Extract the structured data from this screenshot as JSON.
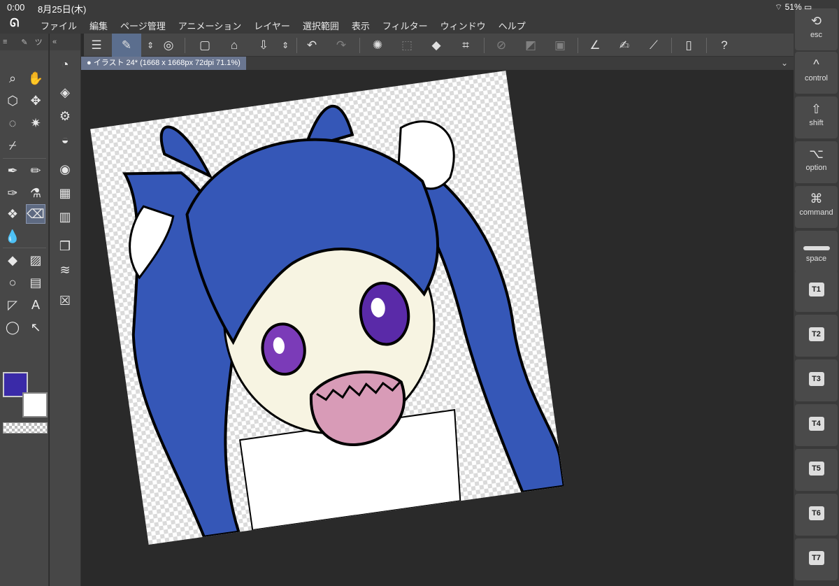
{
  "status": {
    "time": "0:00",
    "date": "8月25日(木)",
    "battery": "51%"
  },
  "menu": [
    "ファイル",
    "編集",
    "ページ管理",
    "アニメーション",
    "レイヤー",
    "選択範囲",
    "表示",
    "フィルター",
    "ウィンドウ",
    "ヘルプ"
  ],
  "document": {
    "tab_label": "● イラスト 24* (1668 x 1668px 72dpi 71.1%)"
  },
  "colors": {
    "main": "#3a2aa8",
    "sub": "#ffffff",
    "hair": "#3557b7",
    "skin": "#f7f4e2",
    "mouth": "#d89bb7",
    "eye": "#5a2aa8"
  },
  "keys": [
    {
      "glyph": "⟲",
      "label": "esc"
    },
    {
      "glyph": "^",
      "label": "control"
    },
    {
      "glyph": "⇧",
      "label": "shift"
    },
    {
      "glyph": "⌥",
      "label": "option"
    },
    {
      "glyph": "⌘",
      "label": "command"
    },
    {
      "glyph": "",
      "label": "space"
    },
    {
      "box": "T1"
    },
    {
      "box": "T2"
    },
    {
      "box": "T3"
    },
    {
      "box": "T4"
    },
    {
      "box": "T5"
    },
    {
      "box": "T6"
    },
    {
      "box": "T7"
    }
  ]
}
